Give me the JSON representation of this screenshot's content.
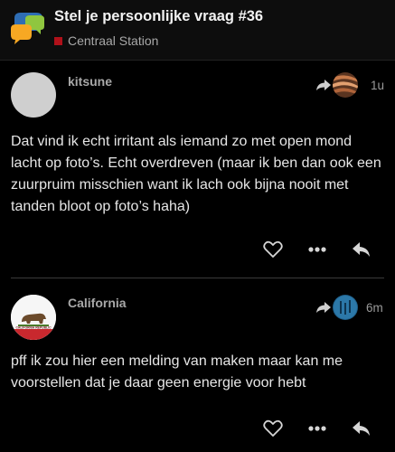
{
  "topic": {
    "title": "Stel je persoonlijke vraag #36",
    "category": "Centraal Station",
    "category_color": "#b0111a"
  },
  "posts": [
    {
      "username": "kitsune",
      "time": "1u",
      "avatar_icon": "default-avatar-icon",
      "reply_to_icon": "reply-arrow-icon",
      "body": "Dat vind ik echt irritant als iemand zo met open mond lacht op foto’s. Echt overdreven (maar ik ben dan ook een zuurpruim misschien want ik lach ook bijna nooit met tanden bloot op foto’s haha)"
    },
    {
      "username": "California",
      "time": "6m",
      "avatar_icon": "california-flag-icon",
      "avatar_text": "CALIFORNIA REPUBLIC",
      "reply_to_icon": "reply-arrow-icon",
      "body": "pff ik zou hier een melding van maken maar kan me voorstellen dat je daar geen energie voor hebt"
    }
  ],
  "actions": {
    "like_icon": "heart-icon",
    "more_icon": "more-dots-icon",
    "reply_icon": "reply-icon"
  }
}
